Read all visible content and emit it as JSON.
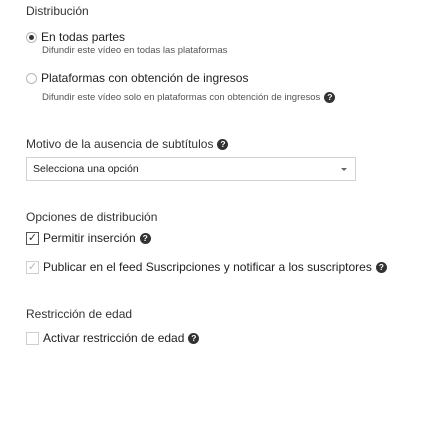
{
  "distribution": {
    "title": "Distribución",
    "options": [
      {
        "label": "En todas partes",
        "description": "Difundir este vídeo en todas las plataformas",
        "selected": true
      },
      {
        "label": "Plataformas con obtención de ingresos",
        "description": "Difundir este vídeo solo en plataformas con obtención de ingresos",
        "selected": false
      }
    ]
  },
  "subtitles": {
    "title": "Motivo de la ausencia de subtítulos",
    "select_value": "Selecciona una opción"
  },
  "distribution_options": {
    "title": "Opciones de distribución",
    "allow_embed": {
      "label": "Permitir inserción",
      "checked": true
    },
    "publish_feed": {
      "label": "Publicar en el feed Suscripciones y notificar a los suscriptores",
      "checked": true
    }
  },
  "age_restriction": {
    "title": "Restricción de edad",
    "activate": {
      "label": "Activar restricción de edad",
      "checked": false
    }
  },
  "icons": {
    "help": "help-icon",
    "help_glyph": "?",
    "check_glyph": "✓",
    "dropdown": "chevron-down-icon"
  },
  "colors": {
    "text": "#222222",
    "muted": "#555555",
    "border": "#d3d3d3",
    "help_bg": "#333333"
  }
}
